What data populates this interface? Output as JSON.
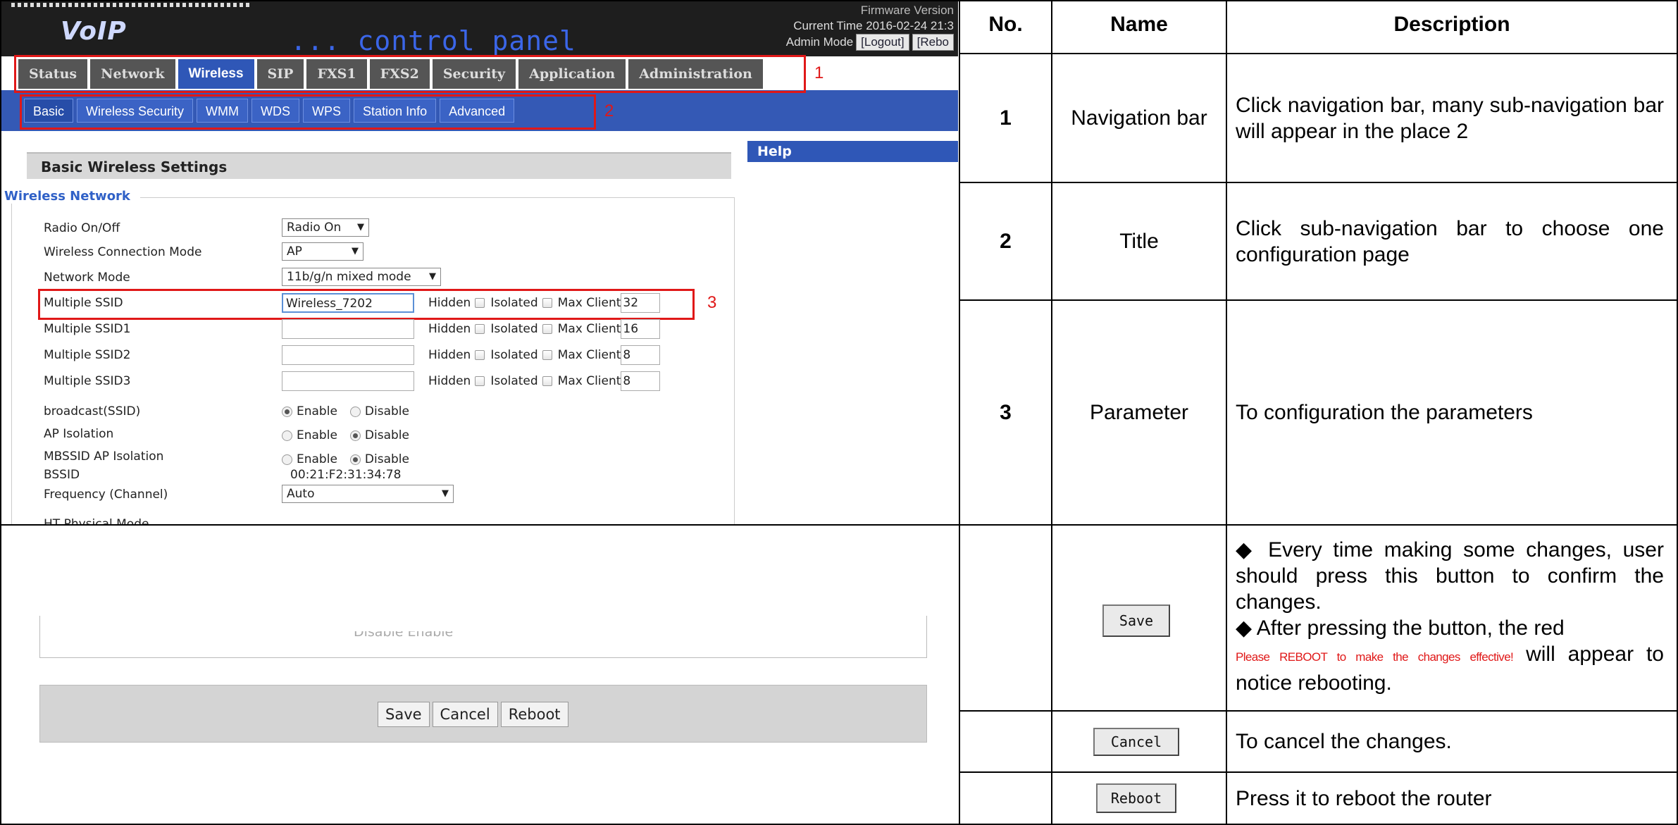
{
  "screenshot_top": {
    "logo": "VoIP",
    "panel_title": "... control panel",
    "firmware_label": "Firmware Version",
    "current_time": "Current Time 2016-02-24 21:3",
    "admin_mode": "Admin Mode",
    "logout_link": "[Logout]",
    "reboot_link": "[Rebo",
    "main_tabs": [
      "Status",
      "Network",
      "Wireless",
      "SIP",
      "FXS1",
      "FXS2",
      "Security",
      "Application",
      "Administration"
    ],
    "sub_tabs": [
      "Basic",
      "Wireless Security",
      "WMM",
      "WDS",
      "WPS",
      "Station Info",
      "Advanced"
    ],
    "help_title": "Help",
    "section_title": "Basic Wireless Settings",
    "legend": "Wireless Network",
    "marker_1": "1",
    "marker_2": "2",
    "marker_3": "3",
    "fields": {
      "radio_label": "Radio On/Off",
      "radio_value": "Radio On",
      "conn_mode_label": "Wireless Connection Mode",
      "conn_mode_value": "AP",
      "net_mode_label": "Network Mode",
      "net_mode_value": "11b/g/n mixed mode",
      "ssid_rows": [
        {
          "label": "Multiple SSID",
          "value": "Wireless_7202",
          "max": "32"
        },
        {
          "label": "Multiple SSID1",
          "value": "",
          "max": "16"
        },
        {
          "label": "Multiple SSID2",
          "value": "",
          "max": "8"
        },
        {
          "label": "Multiple SSID3",
          "value": "",
          "max": "8"
        }
      ],
      "hidden_label": "Hidden",
      "isolated_label": "Isolated",
      "max_client_label": "Max Client",
      "broadcast_label": "broadcast(SSID)",
      "ap_isolation_label": "AP Isolation",
      "mbssid_label": "MBSSID AP Isolation",
      "bssid_label": "BSSID",
      "bssid_value": "00:21:F2:31:34:78",
      "frequency_label": "Frequency (Channel)",
      "frequency_value": "Auto",
      "cut_label": "HT Physical Mode",
      "enable_label": "Enable",
      "disable_label": "Disable"
    }
  },
  "screenshot_bottom": {
    "cut_text": "Disable    Enable",
    "save": "Save",
    "cancel": "Cancel",
    "reboot": "Reboot"
  },
  "table": {
    "headers": {
      "no": "No.",
      "name": "Name",
      "description": "Description"
    },
    "rows": [
      {
        "no": "1",
        "name": "Navigation bar",
        "description": "Click navigation bar, many sub-navigation bar will appear in the place 2"
      },
      {
        "no": "2",
        "name": "Title",
        "description": "Click sub-navigation bar to choose one configuration page"
      },
      {
        "no": "3",
        "name": "Parameter",
        "description": "To configuration the parameters"
      }
    ],
    "save_button": "Save",
    "save_desc_1": "◆ Every time making some changes, user should press this button to confirm the changes.",
    "save_desc_2a": "◆ After pressing the button, the red",
    "save_desc_red": "Please REBOOT to make the changes effective!",
    "save_desc_2b": "will appear to notice rebooting.",
    "cancel_button": "Cancel",
    "cancel_desc": "To cancel the changes.",
    "reboot_button": "Reboot",
    "reboot_desc": "Press it to reboot the router"
  },
  "colors": {
    "accent_blue": "#3459b5",
    "annotation_red": "#e01818",
    "topbar": "#1e1e1e"
  }
}
